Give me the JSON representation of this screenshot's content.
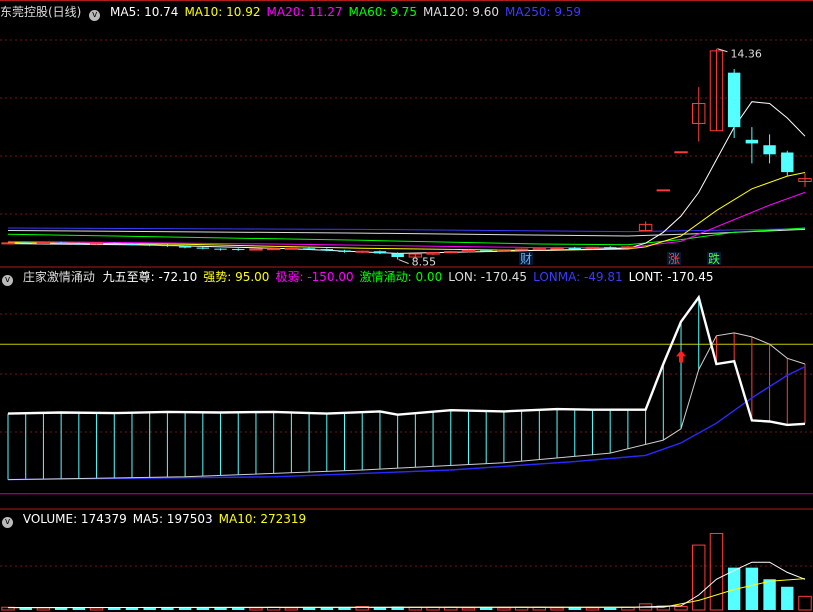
{
  "panels": {
    "price": {
      "title": "东莞控股(日线)",
      "ma_labels": [
        {
          "text": "MA5: 10.74",
          "color": "#ffffff"
        },
        {
          "text": "MA10: 10.92",
          "color": "#ffff00"
        },
        {
          "text": "MA20: 11.27",
          "color": "#ff00ff"
        },
        {
          "text": "MA60: 9.75",
          "color": "#00ff00"
        },
        {
          "text": "MA120: 9.60",
          "color": "#dddddd"
        },
        {
          "text": "MA250: 9.59",
          "color": "#3b3bff"
        }
      ],
      "high_label": "14.36",
      "low_label": "8.55",
      "markers": [
        {
          "text": "财",
          "color": "#6ab0ff"
        },
        {
          "text": "涨",
          "color": "#ff4444"
        },
        {
          "text": "跌",
          "color": "#44ff44"
        }
      ]
    },
    "indicator": {
      "title": "庄家激情涌动",
      "labels": [
        {
          "text": "九五至尊: -72.10",
          "color": "#ffffff"
        },
        {
          "text": "强势: 95.00",
          "color": "#ffff00"
        },
        {
          "text": "极弱: -150.00",
          "color": "#ff00ff"
        },
        {
          "text": "激情涌动: 0.00",
          "color": "#00ff00"
        },
        {
          "text": "LON: -170.45",
          "color": "#dddddd"
        },
        {
          "text": "LONMA: -49.81",
          "color": "#3b3bff"
        },
        {
          "text": "LONT: -170.45",
          "color": "#ffffff"
        }
      ]
    },
    "volume": {
      "labels": [
        {
          "text": "VOLUME: 174379",
          "color": "#ffffff"
        },
        {
          "text": "MA5: 197503",
          "color": "#ffffff"
        },
        {
          "text": "MA10: 272319",
          "color": "#ffff00"
        }
      ]
    }
  },
  "colors": {
    "up": "#ff3c3c",
    "down": "#54ffff",
    "ma5": "#ffffff",
    "ma10": "#ffff00",
    "ma20": "#ff00ff",
    "ma60": "#00ff00",
    "ma120": "#dddddd",
    "ma250": "#3b3bff",
    "grid": "#7a1414",
    "sep": "#b01c1c"
  },
  "chart_data": {
    "type": "candlestick",
    "candles": [
      [
        9.0,
        9.02,
        8.97,
        9.01
      ],
      [
        9.02,
        9.03,
        8.98,
        9.0
      ],
      [
        9.0,
        9.03,
        8.98,
        9.02
      ],
      [
        9.02,
        9.04,
        8.99,
        9.0
      ],
      [
        9.0,
        9.02,
        8.96,
        8.98
      ],
      [
        8.98,
        9.02,
        8.96,
        9.01
      ],
      [
        9.01,
        9.02,
        8.97,
        8.99
      ],
      [
        8.99,
        9.0,
        8.94,
        8.96
      ],
      [
        8.96,
        8.98,
        8.92,
        8.95
      ],
      [
        8.95,
        8.97,
        8.9,
        8.92
      ],
      [
        8.92,
        8.94,
        8.86,
        8.88
      ],
      [
        8.88,
        8.9,
        8.83,
        8.85
      ],
      [
        8.85,
        8.86,
        8.8,
        8.84
      ],
      [
        8.84,
        8.86,
        8.79,
        8.82
      ],
      [
        8.82,
        8.86,
        8.8,
        8.84
      ],
      [
        8.84,
        8.87,
        8.81,
        8.85
      ],
      [
        8.85,
        8.88,
        8.83,
        8.86
      ],
      [
        8.86,
        8.88,
        8.82,
        8.84
      ],
      [
        8.84,
        8.86,
        8.78,
        8.8
      ],
      [
        8.8,
        8.82,
        8.74,
        8.76
      ],
      [
        8.76,
        8.8,
        8.73,
        8.78
      ],
      [
        8.78,
        8.8,
        8.7,
        8.72
      ],
      [
        8.72,
        8.75,
        8.55,
        8.62
      ],
      [
        8.62,
        8.72,
        8.6,
        8.7
      ],
      [
        8.7,
        8.76,
        8.68,
        8.74
      ],
      [
        8.74,
        8.79,
        8.72,
        8.77
      ],
      [
        8.77,
        8.82,
        8.75,
        8.8
      ],
      [
        8.8,
        8.83,
        8.76,
        8.78
      ],
      [
        8.78,
        8.83,
        8.76,
        8.82
      ],
      [
        8.82,
        8.86,
        8.8,
        8.84
      ],
      [
        8.84,
        8.87,
        8.81,
        8.85
      ],
      [
        8.85,
        8.89,
        8.83,
        8.87
      ],
      [
        8.87,
        8.9,
        8.84,
        8.86
      ],
      [
        8.86,
        8.9,
        8.84,
        8.89
      ],
      [
        8.89,
        8.92,
        8.86,
        8.88
      ],
      [
        8.88,
        8.92,
        8.86,
        8.9
      ],
      [
        9.35,
        9.6,
        9.33,
        9.52
      ],
      [
        10.46,
        10.47,
        10.46,
        10.47
      ],
      [
        11.5,
        11.52,
        11.5,
        11.52
      ],
      [
        12.3,
        13.3,
        11.8,
        12.85
      ],
      [
        12.1,
        14.36,
        12.1,
        14.3
      ],
      [
        13.7,
        13.8,
        11.9,
        12.2
      ],
      [
        11.85,
        12.2,
        11.2,
        11.75
      ],
      [
        11.7,
        12.0,
        11.2,
        11.45
      ],
      [
        11.5,
        11.55,
        10.85,
        10.96
      ],
      [
        10.7,
        10.92,
        10.55,
        10.78
      ]
    ],
    "ma": {
      "ma5": [
        [
          0,
          8.99
        ],
        [
          8,
          8.95
        ],
        [
          16,
          8.85
        ],
        [
          22,
          8.72
        ],
        [
          28,
          8.78
        ],
        [
          35,
          8.86
        ],
        [
          36,
          9.0
        ],
        [
          37,
          9.3
        ],
        [
          38,
          9.75
        ],
        [
          39,
          10.4
        ],
        [
          40,
          11.3
        ],
        [
          41,
          12.2
        ],
        [
          42,
          12.9
        ],
        [
          43,
          12.85
        ],
        [
          44,
          12.45
        ],
        [
          45,
          11.95
        ]
      ],
      "ma10": [
        [
          0,
          9.02
        ],
        [
          10,
          8.97
        ],
        [
          20,
          8.86
        ],
        [
          30,
          8.8
        ],
        [
          35,
          8.84
        ],
        [
          36,
          8.9
        ],
        [
          38,
          9.2
        ],
        [
          40,
          9.9
        ],
        [
          42,
          10.5
        ],
        [
          44,
          10.85
        ],
        [
          45,
          10.95
        ]
      ],
      "ma20": [
        [
          0,
          9.05
        ],
        [
          15,
          8.98
        ],
        [
          30,
          8.88
        ],
        [
          35,
          8.88
        ],
        [
          38,
          9.05
        ],
        [
          40,
          9.45
        ],
        [
          43,
          10.05
        ],
        [
          45,
          10.4
        ]
      ],
      "ma60": [
        [
          0,
          9.25
        ],
        [
          20,
          9.08
        ],
        [
          30,
          8.98
        ],
        [
          35,
          8.96
        ],
        [
          38,
          9.1
        ],
        [
          41,
          9.3
        ],
        [
          45,
          9.42
        ]
      ],
      "ma120": [
        [
          0,
          9.35
        ],
        [
          20,
          9.28
        ],
        [
          35,
          9.2
        ],
        [
          40,
          9.28
        ],
        [
          45,
          9.38
        ]
      ],
      "ma250": [
        [
          0,
          9.42
        ],
        [
          20,
          9.38
        ],
        [
          35,
          9.32
        ],
        [
          40,
          9.36
        ],
        [
          45,
          9.4
        ]
      ]
    },
    "indicator": {
      "white": [
        [
          0,
          -28
        ],
        [
          3,
          -26
        ],
        [
          6,
          -27
        ],
        [
          9,
          -25
        ],
        [
          12,
          -26
        ],
        [
          15,
          -25
        ],
        [
          18,
          -28
        ],
        [
          21,
          -24
        ],
        [
          22,
          -30
        ],
        [
          25,
          -22
        ],
        [
          28,
          -24
        ],
        [
          31,
          -20
        ],
        [
          33,
          -21
        ],
        [
          35,
          -21
        ],
        [
          36,
          -21
        ],
        [
          37,
          60
        ],
        [
          38,
          135
        ],
        [
          39,
          178
        ],
        [
          40,
          60
        ],
        [
          41,
          65
        ],
        [
          42,
          -40
        ],
        [
          43,
          -42
        ],
        [
          44,
          -48
        ],
        [
          45,
          -46
        ]
      ],
      "gray": [
        [
          0,
          -145
        ],
        [
          10,
          -140
        ],
        [
          20,
          -128
        ],
        [
          28,
          -115
        ],
        [
          34,
          -98
        ],
        [
          37,
          -75
        ],
        [
          38,
          -55
        ],
        [
          39,
          50
        ],
        [
          40,
          110
        ],
        [
          41,
          115
        ],
        [
          42,
          108
        ],
        [
          43,
          95
        ],
        [
          44,
          70
        ],
        [
          45,
          60
        ]
      ],
      "blue": [
        [
          0,
          -145
        ],
        [
          15,
          -140
        ],
        [
          25,
          -128
        ],
        [
          32,
          -113
        ],
        [
          36,
          -102
        ],
        [
          38,
          -80
        ],
        [
          40,
          -45
        ],
        [
          42,
          0
        ],
        [
          44,
          40
        ],
        [
          45,
          55
        ]
      ],
      "bars_from": -30,
      "arrow_x": 38,
      "arrow_y": 70,
      "ylim": [
        -190,
        200
      ]
    },
    "volume": [
      4,
      3,
      3,
      4,
      3,
      3,
      4,
      3,
      3,
      3,
      3,
      3,
      4,
      3,
      3,
      4,
      3,
      3,
      4,
      4,
      5,
      4,
      5,
      4,
      4,
      4,
      3,
      4,
      3,
      4,
      4,
      3,
      4,
      3,
      3,
      4,
      9,
      6,
      5,
      95,
      112,
      62,
      62,
      45,
      34,
      20
    ],
    "volume_ma5": [
      [
        0,
        3.5
      ],
      [
        20,
        4
      ],
      [
        35,
        4
      ],
      [
        38,
        6
      ],
      [
        39,
        22
      ],
      [
        40,
        45
      ],
      [
        41,
        58
      ],
      [
        42,
        70
      ],
      [
        43,
        70
      ],
      [
        44,
        55
      ],
      [
        45,
        45
      ]
    ],
    "volume_ma10": [
      [
        0,
        3.5
      ],
      [
        25,
        4
      ],
      [
        37,
        4
      ],
      [
        39,
        14
      ],
      [
        41,
        30
      ],
      [
        43,
        42
      ],
      [
        45,
        46
      ]
    ]
  }
}
